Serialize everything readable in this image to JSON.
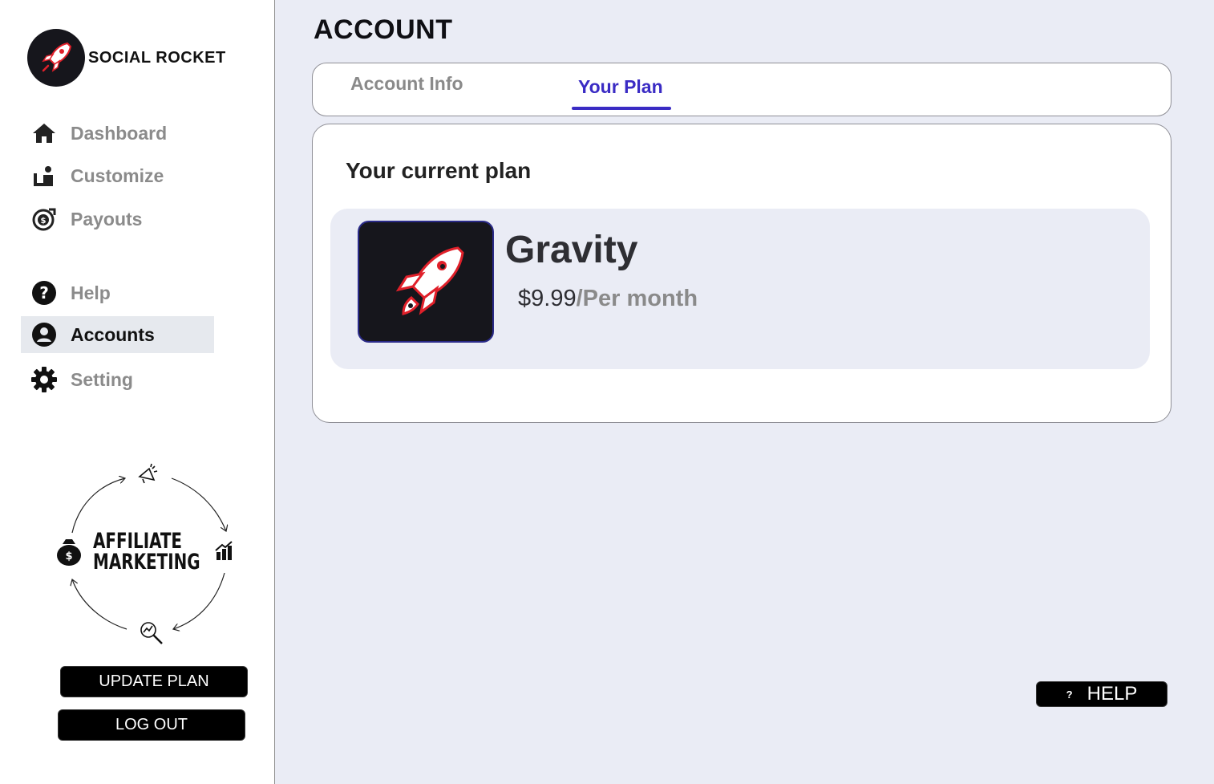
{
  "brand": {
    "name": "SOCIAL ROCKET",
    "icon": "rocket-icon"
  },
  "sidebar": {
    "items": [
      {
        "label": "Dashboard",
        "icon": "home-icon",
        "active": false
      },
      {
        "label": "Customize",
        "icon": "customize-icon",
        "active": false
      },
      {
        "label": "Payouts",
        "icon": "payouts-icon",
        "active": false
      },
      {
        "label": "Help",
        "icon": "help-icon",
        "active": false
      },
      {
        "label": "Accounts",
        "icon": "account-icon",
        "active": true
      },
      {
        "label": "Setting",
        "icon": "gear-icon",
        "active": false
      }
    ],
    "affiliate": {
      "line1": "AFFILIATE",
      "line2": "MARKETING"
    },
    "update_plan_label": "UPDATE PLAN",
    "logout_label": "LOG OUT"
  },
  "main": {
    "title": "ACCOUNT",
    "tabs": [
      {
        "label": "Account Info",
        "active": false
      },
      {
        "label": "Your Plan",
        "active": true
      }
    ],
    "plan": {
      "heading": "Your current plan",
      "name": "Gravity",
      "price": "$9.99",
      "period": "/Per month"
    },
    "help_button": {
      "icon_text": "?",
      "label": "HELP"
    }
  },
  "colors": {
    "accent": "#3a2bc4",
    "background": "#eaecf5",
    "rocket_red": "#e0202a"
  }
}
